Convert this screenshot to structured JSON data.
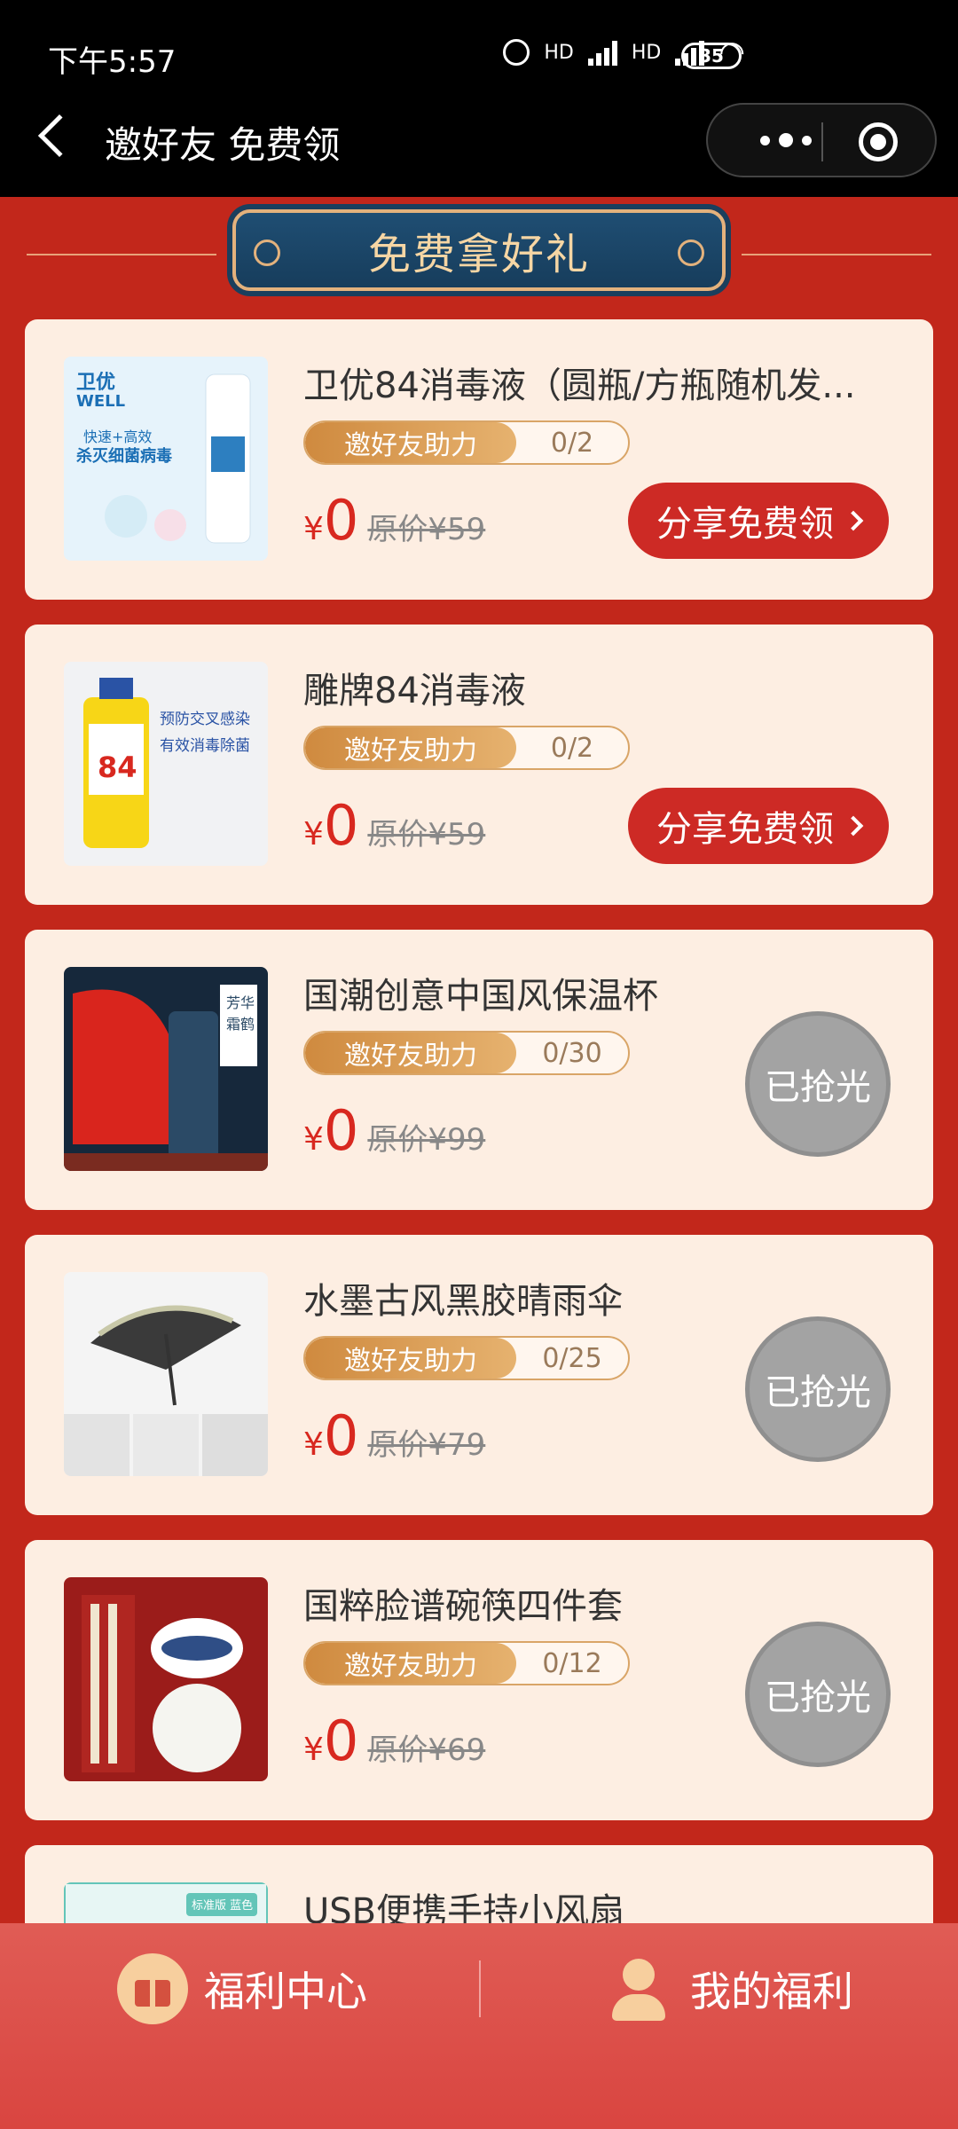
{
  "status_bar": {
    "time": "下午5:57",
    "battery": "35",
    "network_a": "HD",
    "network_b": "HD"
  },
  "header": {
    "title": "邀好友 免费领"
  },
  "section": {
    "title": "免费拿好礼"
  },
  "products": [
    {
      "name": "卫优84消毒液（圆瓶/方瓶随机发...",
      "assist_label": "邀好友助力",
      "progress": "0/2",
      "currency": "¥",
      "price": "0",
      "original_price": "原价¥59",
      "action": "分享免费领",
      "status": "available",
      "thumb_text": "卫优 WELL 快速+高效 杀灭细菌病毒"
    },
    {
      "name": "雕牌84消毒液",
      "assist_label": "邀好友助力",
      "progress": "0/2",
      "currency": "¥",
      "price": "0",
      "original_price": "原价¥59",
      "action": "分享免费领",
      "status": "available",
      "thumb_text": "预防交叉感染 有效消毒除菌"
    },
    {
      "name": "国潮创意中国风保温杯",
      "assist_label": "邀好友助力",
      "progress": "0/30",
      "currency": "¥",
      "price": "0",
      "original_price": "原价¥99",
      "action": "已抢光",
      "status": "sold_out",
      "thumb_text": "芳华霜鹤"
    },
    {
      "name": "水墨古风黑胶晴雨伞",
      "assist_label": "邀好友助力",
      "progress": "0/25",
      "currency": "¥",
      "price": "0",
      "original_price": "原价¥79",
      "action": "已抢光",
      "status": "sold_out"
    },
    {
      "name": "国粹脸谱碗筷四件套",
      "assist_label": "邀好友助力",
      "progress": "0/12",
      "currency": "¥",
      "price": "0",
      "original_price": "原价¥69",
      "action": "已抢光",
      "status": "sold_out"
    },
    {
      "name": "USB便携手持小风扇",
      "thumb_text": "标准版 蓝色"
    }
  ],
  "bottom_nav": {
    "welfare_center": "福利中心",
    "my_welfare": "我的福利"
  },
  "colors": {
    "background": "#c2271b",
    "card": "#fdeee2",
    "price_red": "#d8281f",
    "button_red": "#cd2a25",
    "gold": "#d9a567",
    "banner_blue": "#1f4e73"
  }
}
